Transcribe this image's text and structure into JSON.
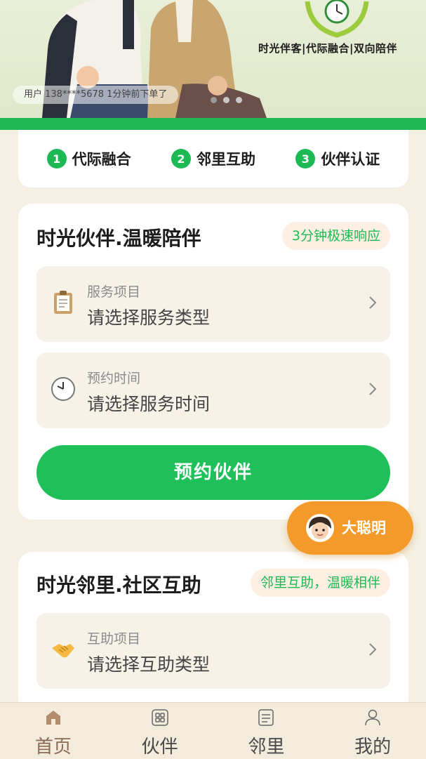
{
  "banner": {
    "slogan": "时光伴客|代际融合|双向陪伴",
    "ticker": "用户 138****5678 1分钟前下单了",
    "slide_count": 3,
    "active_slide": 1
  },
  "steps": [
    {
      "num": "1",
      "label": "代际融合"
    },
    {
      "num": "2",
      "label": "邻里互助"
    },
    {
      "num": "3",
      "label": "伙伴认证"
    }
  ],
  "partner_card": {
    "title": "时光伙伴.温暖陪伴",
    "badge": "3分钟极速响应",
    "fields": [
      {
        "icon": "clipboard-icon",
        "label": "服务项目",
        "value": "请选择服务类型"
      },
      {
        "icon": "clock-icon",
        "label": "预约时间",
        "value": "请选择服务时间"
      }
    ],
    "button": "预约伙伴"
  },
  "assistant": {
    "label": "大聪明"
  },
  "neighbor_card": {
    "title": "时光邻里.社区互助",
    "badge": "邻里互助，温暖相伴",
    "fields": [
      {
        "icon": "handshake-icon",
        "label": "互助项目",
        "value": "请选择互助类型"
      }
    ]
  },
  "tabbar": {
    "items": [
      {
        "icon": "home-icon",
        "label": "首页",
        "active": true
      },
      {
        "icon": "grid-icon",
        "label": "伙伴",
        "active": false
      },
      {
        "icon": "document-icon",
        "label": "邻里",
        "active": false
      },
      {
        "icon": "user-icon",
        "label": "我的",
        "active": false
      }
    ]
  },
  "colors": {
    "brand_green": "#1db954",
    "background": "#f5f0e3",
    "assistant_orange": "#f39a2b",
    "active_tab": "#8a6b55"
  }
}
